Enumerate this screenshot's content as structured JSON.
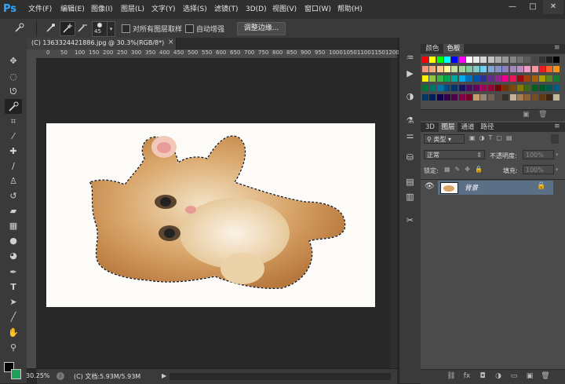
{
  "app": {
    "logo": "Ps"
  },
  "menu": [
    "文件(F)",
    "编辑(E)",
    "图像(I)",
    "图层(L)",
    "文字(Y)",
    "选择(S)",
    "滤镜(T)",
    "3D(D)",
    "视图(V)",
    "窗口(W)",
    "帮助(H)"
  ],
  "window_controls": {
    "minimize": "—",
    "maximize": "□",
    "close": "✕"
  },
  "options": {
    "brush_size": "45",
    "sample_all_layers_label": "对所有图层取样",
    "auto_enhance_label": "自动增强",
    "refine_edge_label": "调整边缘..."
  },
  "document": {
    "tab_title": "(C) 1363324421886.jpg @ 30.3%(RGB/8*)",
    "tab_close": "×",
    "ruler_ticks": [
      "0",
      "50",
      "100",
      "150",
      "200",
      "250",
      "300",
      "350",
      "400",
      "450",
      "500",
      "550",
      "600",
      "650",
      "700",
      "750",
      "800",
      "850",
      "900",
      "950",
      "1000",
      "1050",
      "1100",
      "1150",
      "1200"
    ]
  },
  "status": {
    "zoom": "30.25%",
    "doc_info": "(C) 文档:5.93M/5.93M"
  },
  "panels": {
    "color_tabs": [
      "颜色",
      "色板"
    ],
    "color_active": "色板",
    "layer_tabs": [
      "3D",
      "图层",
      "通道",
      "路径"
    ],
    "layer_active": "图层",
    "filter_kind": "类型",
    "blend_mode": "正常",
    "opacity_label": "不透明度:",
    "opacity_value": "100%",
    "lock_label": "锁定:",
    "fill_label": "填充:",
    "fill_value": "100%",
    "layer_name": "背景"
  },
  "colors": {
    "accent": "#5b6f86",
    "foreground": "#000000",
    "background": "#1fa05a",
    "swatch_rows": [
      [
        "#ff0000",
        "#ffff00",
        "#00ff00",
        "#00ffff",
        "#0000ff",
        "#ff00ff",
        "#ffffff",
        "#ebebeb",
        "#d6d6d6",
        "#c2c2c2",
        "#adadad",
        "#999999",
        "#858585",
        "#707070",
        "#5c5c5c",
        "#474747",
        "#333333",
        "#1f1f1f",
        "#000000"
      ],
      [
        "#f7977a",
        "#f9ad81",
        "#fdc68a",
        "#fff79a",
        "#c4df9b",
        "#a2d39c",
        "#82ca9d",
        "#7bcdc8",
        "#6ecff6",
        "#7ea7d8",
        "#8493ca",
        "#8882be",
        "#a187be",
        "#bc8dbf",
        "#f49ac2",
        "#f6989d",
        "#ed1c24",
        "#f26522",
        "#f7941d"
      ],
      [
        "#fff200",
        "#8dc63f",
        "#39b54a",
        "#00a651",
        "#00a99d",
        "#00aeef",
        "#0072bc",
        "#0054a6",
        "#2e3192",
        "#662d91",
        "#92278f",
        "#ec008c",
        "#ed145b",
        "#9e0b0f",
        "#a0410d",
        "#a36209",
        "#aba000",
        "#598527",
        "#197b30"
      ],
      [
        "#007236",
        "#00746b",
        "#0076a3",
        "#004b80",
        "#003471",
        "#1b1464",
        "#440e62",
        "#630460",
        "#9e005d",
        "#9e0039",
        "#790000",
        "#7b2e00",
        "#7d4900",
        "#827b00",
        "#406618",
        "#005e20",
        "#005826",
        "#005952",
        "#005b7f"
      ],
      [
        "#003663",
        "#002157",
        "#0d004c",
        "#32004b",
        "#4b0049",
        "#7b0046",
        "#7a0026",
        "#c69c6d",
        "#998675",
        "#736357",
        "#534741",
        "#37302a",
        "#c7b299",
        "#a67c52",
        "#8c6239",
        "#754c24",
        "#603913",
        "#3c2415",
        "#c2b59b"
      ]
    ]
  }
}
